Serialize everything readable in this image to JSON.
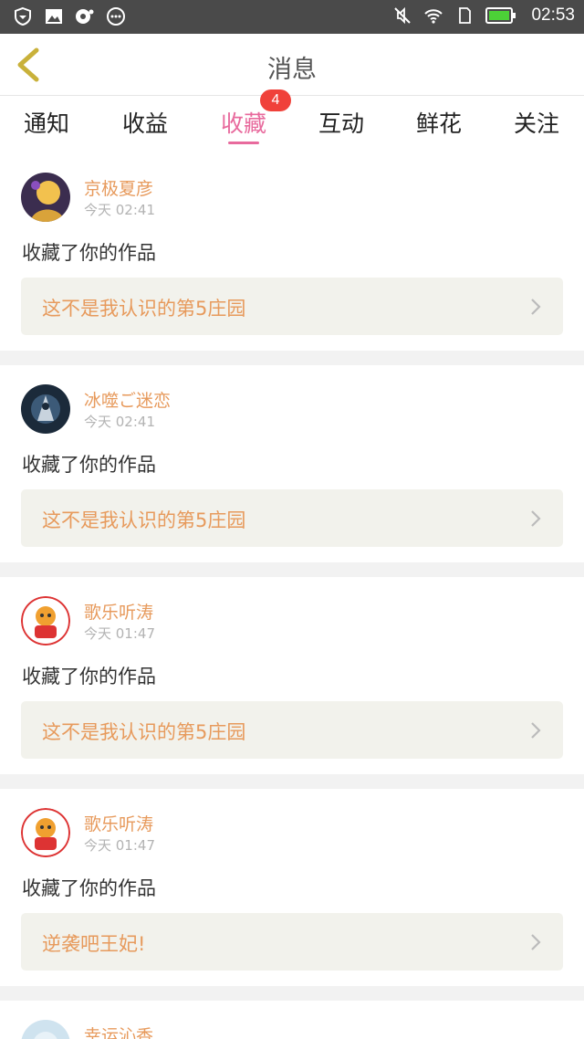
{
  "status_bar": {
    "time": "02:53",
    "left_icons": [
      "shield-icon",
      "image-icon",
      "music-icon",
      "more-dots-icon"
    ],
    "right_icons": [
      "mute-icon",
      "wifi-icon",
      "sim-icon",
      "battery-icon"
    ]
  },
  "header": {
    "title": "消息"
  },
  "tabs": [
    {
      "label": "通知"
    },
    {
      "label": "收益"
    },
    {
      "label": "收藏"
    },
    {
      "label": "互动"
    },
    {
      "label": "鲜花"
    },
    {
      "label": "关注"
    }
  ],
  "active_tab": "收藏",
  "badge_count": "4",
  "colors": {
    "accent": "#e86a9d",
    "username": "#e79a5c",
    "badge": "#f0413a"
  },
  "messages": [
    {
      "user": "京极夏彦",
      "time": "今天 02:41",
      "action": "收藏了你的作品",
      "work": "这不是我认识的第5庄园"
    },
    {
      "user": "冰噬ご迷恋",
      "time": "今天 02:41",
      "action": "收藏了你的作品",
      "work": "这不是我认识的第5庄园"
    },
    {
      "user": "歌乐听涛",
      "time": "今天 01:47",
      "action": "收藏了你的作品",
      "work": "这不是我认识的第5庄园"
    },
    {
      "user": "歌乐听涛",
      "time": "今天 01:47",
      "action": "收藏了你的作品",
      "work": "逆袭吧王妃!"
    },
    {
      "user": "幸运沁香"
    }
  ]
}
